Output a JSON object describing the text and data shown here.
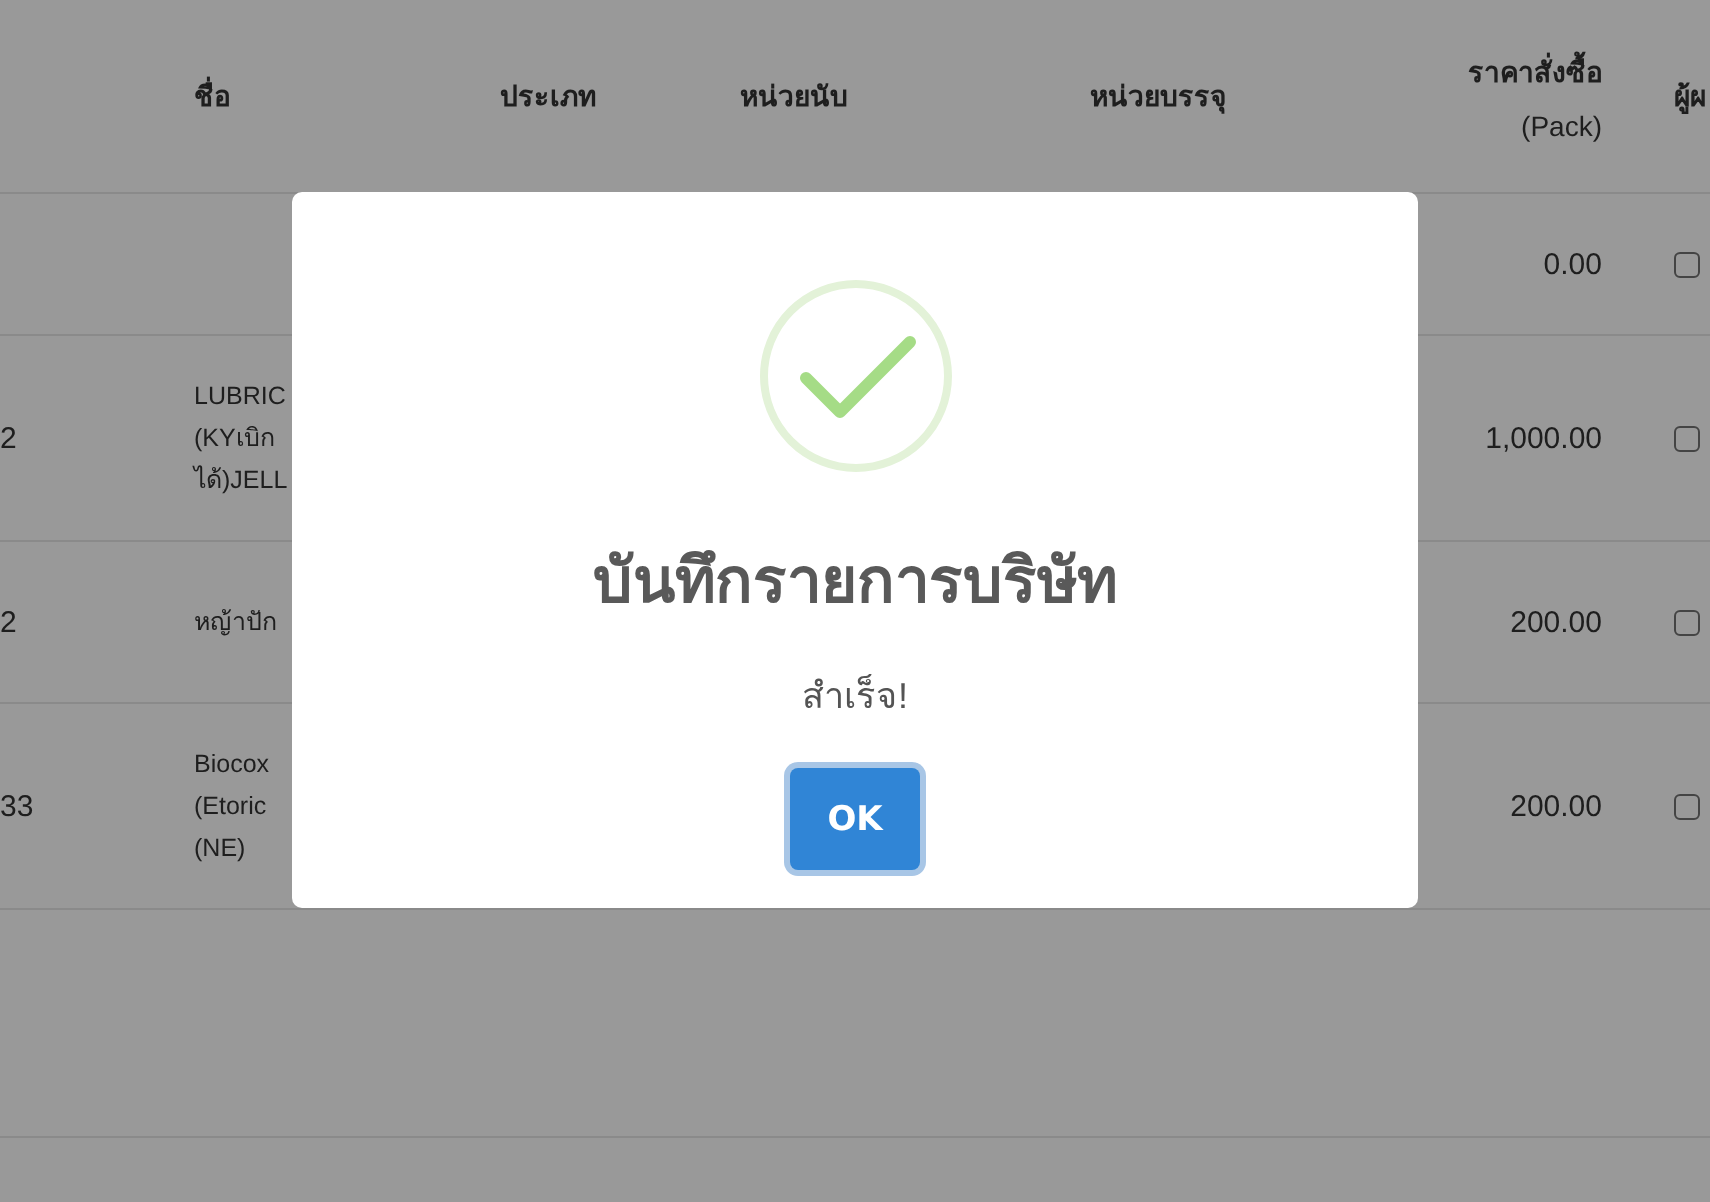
{
  "table": {
    "columns": [
      {
        "label": "ชื่อ"
      },
      {
        "label": "ประเภท"
      },
      {
        "label": "หน่วยนับ"
      },
      {
        "label": "หน่วยบรรจุ"
      },
      {
        "label": "ราคาสั่งซื้อ",
        "sublabel": "(Pack)"
      },
      {
        "label": "ผู้ผ"
      }
    ],
    "rows": [
      {
        "price": "0.00",
        "checked": false
      },
      {
        "code": "2",
        "name": "LUBRIC\n(KYเบิก\nได้)JELL",
        "price": "1,000.00",
        "checked": false
      },
      {
        "code": "2",
        "name": "หญ้าปัก",
        "price": "200.00",
        "checked": false
      },
      {
        "code": "33",
        "name": "Biocox\n(Etoric\n(NE)",
        "price": "200.00",
        "checked": false
      }
    ]
  },
  "dialog": {
    "title": "บันทึกรายการบริษัท",
    "message": "สำเร็จ!",
    "button": "OK"
  }
}
